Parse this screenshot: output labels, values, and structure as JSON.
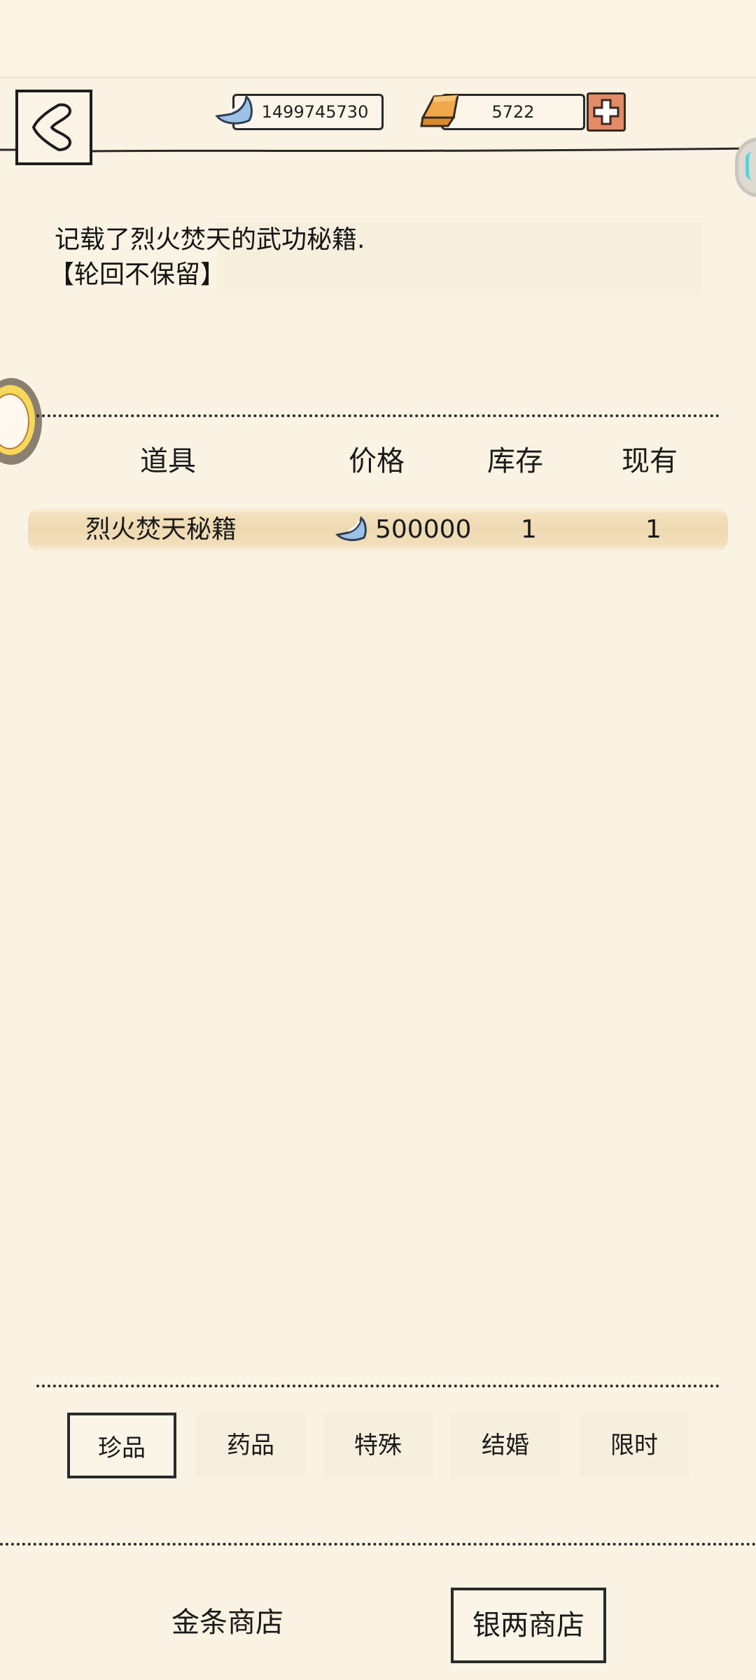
{
  "currency": {
    "silver_amount": "1499745730",
    "gold_amount": "5722"
  },
  "item_description": {
    "line1": "记载了烈火焚天的武功秘籍.",
    "line2": "【轮回不保留】"
  },
  "table": {
    "headers": [
      "道具",
      "价格",
      "库存",
      "现有"
    ],
    "rows": [
      {
        "name": "烈火焚天秘籍",
        "price": "500000",
        "stock": "1",
        "owned": "1"
      }
    ]
  },
  "category_tabs": [
    {
      "label": "珍品",
      "selected": true
    },
    {
      "label": "药品",
      "selected": false
    },
    {
      "label": "特殊",
      "selected": false
    },
    {
      "label": "结婚",
      "selected": false
    },
    {
      "label": "限时",
      "selected": false
    }
  ],
  "shop_tabs": [
    {
      "label": "金条商店",
      "selected": false
    },
    {
      "label": "银两商店",
      "selected": true
    }
  ],
  "icons": {
    "back": "back-arrow-icon",
    "silver": "silver-ingot-icon",
    "gold": "gold-bar-icon",
    "add": "plus-icon"
  },
  "colors": {
    "background": "#faf3e3",
    "row_highlight": "#eed9b2",
    "add_button": "#e38a67",
    "gold": "#e89a3c",
    "silver": "#8fb3d9"
  }
}
